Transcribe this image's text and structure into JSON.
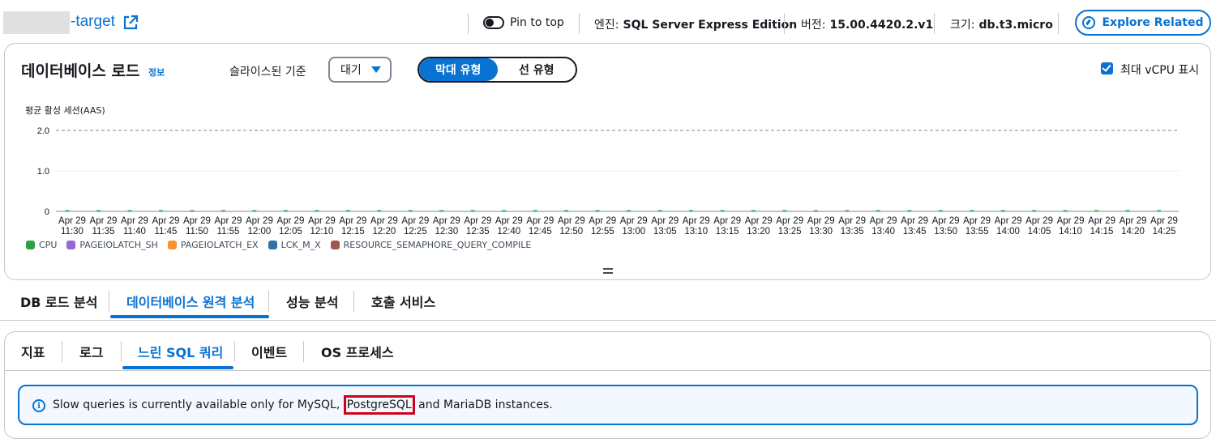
{
  "header": {
    "title": "-target",
    "pin_label": "Pin to top",
    "engine_label": "엔진:",
    "engine_value": "SQL Server Express Edition",
    "version_label": "버전:",
    "version_value": "15.00.4420.2.v1",
    "size_label": "크기:",
    "size_value": "db.t3.micro",
    "explore_label": "Explore Related"
  },
  "load_panel": {
    "title": "데이터베이스 로드",
    "info": "정보",
    "slice_label": "슬라이스된 기준",
    "slice_value": "대기",
    "seg_bar": "막대 유형",
    "seg_line": "선 유형",
    "max_vcpu_label": "최대 vCPU 표시",
    "y_axis_title": "평균 활성 세션(AAS)"
  },
  "chart_data": {
    "type": "bar",
    "ylabel": "평균 활성 세션(AAS)",
    "ylim": [
      0,
      2.0
    ],
    "yticks": [
      "0",
      "1.0",
      "2.0"
    ],
    "max_vcpu_line": 2.0,
    "x_ticks": [
      [
        "Apr 29",
        "11:30"
      ],
      [
        "Apr 29",
        "11:35"
      ],
      [
        "Apr 29",
        "11:40"
      ],
      [
        "Apr 29",
        "11:45"
      ],
      [
        "Apr 29",
        "11:50"
      ],
      [
        "Apr 29",
        "11:55"
      ],
      [
        "Apr 29",
        "12:00"
      ],
      [
        "Apr 29",
        "12:05"
      ],
      [
        "Apr 29",
        "12:10"
      ],
      [
        "Apr 29",
        "12:15"
      ],
      [
        "Apr 29",
        "12:20"
      ],
      [
        "Apr 29",
        "12:25"
      ],
      [
        "Apr 29",
        "12:30"
      ],
      [
        "Apr 29",
        "12:35"
      ],
      [
        "Apr 29",
        "12:40"
      ],
      [
        "Apr 29",
        "12:45"
      ],
      [
        "Apr 29",
        "12:50"
      ],
      [
        "Apr 29",
        "12:55"
      ],
      [
        "Apr 29",
        "13:00"
      ],
      [
        "Apr 29",
        "13:05"
      ],
      [
        "Apr 29",
        "13:10"
      ],
      [
        "Apr 29",
        "13:15"
      ],
      [
        "Apr 29",
        "13:20"
      ],
      [
        "Apr 29",
        "13:25"
      ],
      [
        "Apr 29",
        "13:30"
      ],
      [
        "Apr 29",
        "13:35"
      ],
      [
        "Apr 29",
        "13:40"
      ],
      [
        "Apr 29",
        "13:45"
      ],
      [
        "Apr 29",
        "13:50"
      ],
      [
        "Apr 29",
        "13:55"
      ],
      [
        "Apr 29",
        "14:00"
      ],
      [
        "Apr 29",
        "14:05"
      ],
      [
        "Apr 29",
        "14:10"
      ],
      [
        "Apr 29",
        "14:15"
      ],
      [
        "Apr 29",
        "14:20"
      ],
      [
        "Apr 29",
        "14:25"
      ]
    ],
    "series": [
      {
        "name": "CPU",
        "color": "#2ea043",
        "values": [
          0.02,
          0.01,
          0.02,
          0.01,
          0.02,
          0.01,
          0.02,
          0.02,
          0.01,
          0.02,
          0.02,
          0.01,
          0.02,
          0.01,
          0.02,
          0.01,
          0.02,
          0.02,
          0.01,
          0.02,
          0.01,
          0.02,
          0.02,
          0.01,
          0.02,
          0.03,
          0.01,
          0.02,
          0.02,
          0.01,
          0.02,
          0.01,
          0.02,
          0.01,
          0.02,
          0.02
        ]
      },
      {
        "name": "PAGEIOLATCH_SH",
        "color": "#9469d6",
        "values": [
          0,
          0,
          0,
          0,
          0,
          0,
          0,
          0,
          0,
          0,
          0,
          0,
          0,
          0,
          0,
          0,
          0,
          0,
          0,
          0,
          0,
          0,
          0,
          0,
          0,
          0,
          0,
          0,
          0,
          0,
          0,
          0,
          0,
          0,
          0,
          0
        ]
      },
      {
        "name": "PAGEIOLATCH_EX",
        "color": "#f89233",
        "values": [
          0,
          0,
          0,
          0,
          0,
          0,
          0,
          0,
          0,
          0,
          0,
          0,
          0,
          0,
          0,
          0,
          0,
          0,
          0,
          0,
          0,
          0,
          0,
          0,
          0,
          0,
          0,
          0,
          0,
          0,
          0,
          0,
          0,
          0,
          0,
          0
        ]
      },
      {
        "name": "LCK_M_X",
        "color": "#2e6fac",
        "values": [
          0,
          0,
          0,
          0,
          0,
          0,
          0,
          0,
          0,
          0,
          0,
          0,
          0,
          0,
          0,
          0,
          0,
          0,
          0,
          0,
          0,
          0,
          0,
          0,
          0,
          0,
          0,
          0,
          0,
          0,
          0,
          0,
          0,
          0,
          0,
          0
        ]
      },
      {
        "name": "RESOURCE_SEMAPHORE_QUERY_COMPILE",
        "color": "#a0564c",
        "values": [
          0,
          0,
          0,
          0,
          0,
          0,
          0,
          0,
          0,
          0,
          0,
          0,
          0,
          0,
          0,
          0,
          0,
          0,
          0,
          0,
          0,
          0,
          0,
          0,
          0,
          0,
          0,
          0,
          0,
          0,
          0,
          0,
          0,
          0,
          0,
          0
        ]
      }
    ]
  },
  "main_tabs": [
    "DB 로드 분석",
    "데이터베이스 원격 분석",
    "성능 분석",
    "호출 서비스"
  ],
  "sub_tabs": [
    "지표",
    "로그",
    "느린 SQL 쿼리",
    "이벤트",
    "OS 프로세스"
  ],
  "alert": {
    "text_before": "Slow queries is currently available only for MySQL,",
    "highlight": "PostgreSQL",
    "text_after": "and MariaDB instances."
  }
}
